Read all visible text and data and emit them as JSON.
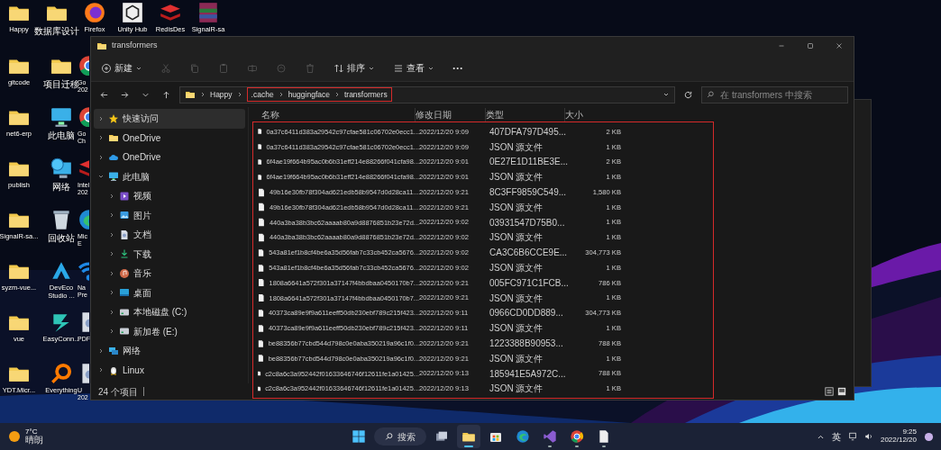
{
  "desktop": {
    "top_row": [
      {
        "label": "Happy",
        "kind": "folder"
      },
      {
        "label": "数据库设计",
        "kind": "folder"
      },
      {
        "label": "Firefox",
        "kind": "browser"
      },
      {
        "label": "Unity Hub",
        "kind": "cube"
      },
      {
        "label": "RedisDes",
        "kind": "stack"
      },
      {
        "label": "SignalR-sa",
        "kind": "archive"
      }
    ],
    "icons": [
      {
        "label": "gitcode",
        "kind": "folder"
      },
      {
        "label": "项目迁移",
        "kind": "folder"
      },
      {
        "label": "Go\n202",
        "kind": "chrome"
      },
      {
        "label": "net6-erp",
        "kind": "folder"
      },
      {
        "label": "此电脑",
        "kind": "monitor"
      },
      {
        "label": "Go\nCh",
        "kind": "chrome"
      },
      {
        "label": "publish",
        "kind": "folder"
      },
      {
        "label": "网络",
        "kind": "globe"
      },
      {
        "label": "Intel\n202",
        "kind": "stack"
      },
      {
        "label": "SignalR-sa...",
        "kind": "folder"
      },
      {
        "label": "回收站",
        "kind": "bin"
      },
      {
        "label": "Mic\nE",
        "kind": "edge"
      },
      {
        "label": "syzm-vue...",
        "kind": "folder"
      },
      {
        "label": "DevEco\nStudio ...",
        "kind": "deveco"
      },
      {
        "label": "Na\nPre",
        "kind": "signal"
      },
      {
        "label": "vue",
        "kind": "folder"
      },
      {
        "label": "EasyConn...",
        "kind": "easy"
      },
      {
        "label": "PDF",
        "kind": "doc"
      },
      {
        "label": "YDT.Micr...",
        "kind": "folder"
      },
      {
        "label": "Everything",
        "kind": "ring"
      },
      {
        "label": "U\n202",
        "kind": "doc"
      }
    ]
  },
  "explorer": {
    "title": "transformers",
    "toolbar": {
      "new": "新建",
      "sort": "排序",
      "view": "查看",
      "more": "···"
    },
    "path": [
      "Happy",
      ".cache",
      "huggingface",
      "transformers"
    ],
    "search_placeholder": "在 transformers 中搜索",
    "sidebar": [
      {
        "label": "快速访问",
        "kind": "star",
        "selected": true,
        "expanded": false
      },
      {
        "label": "OneDrive",
        "kind": "folder",
        "selected": false,
        "expanded": false
      },
      {
        "label": "OneDrive",
        "kind": "cloud",
        "selected": false,
        "expanded": false
      },
      {
        "label": "此电脑",
        "kind": "monitor",
        "selected": false,
        "expanded": true,
        "children": [
          {
            "label": "视频",
            "kind": "video",
            "selected": false,
            "expanded": false
          },
          {
            "label": "图片",
            "kind": "picture",
            "selected": false,
            "expanded": false
          },
          {
            "label": "文档",
            "kind": "doc",
            "selected": false,
            "expanded": false
          },
          {
            "label": "下载",
            "kind": "download",
            "selected": false,
            "expanded": false
          },
          {
            "label": "音乐",
            "kind": "music",
            "selected": false,
            "expanded": false
          },
          {
            "label": "桌面",
            "kind": "desktop",
            "selected": false,
            "expanded": false
          },
          {
            "label": "本地磁盘 (C:)",
            "kind": "drive",
            "selected": false,
            "expanded": false
          },
          {
            "label": "新加卷 (E:)",
            "kind": "drive",
            "selected": false,
            "expanded": false
          }
        ]
      },
      {
        "label": "网络",
        "kind": "network",
        "selected": false,
        "expanded": false
      },
      {
        "label": "Linux",
        "kind": "penguin",
        "selected": false,
        "expanded": false
      }
    ],
    "columns": [
      "名称",
      "修改日期",
      "类型",
      "大小"
    ],
    "files": [
      {
        "name": "0a37c6411d383a29542c97cfae581c06702e0ecc1...",
        "date": "2022/12/20 9:09",
        "type": "407DFA797D495...",
        "size": "2 KB"
      },
      {
        "name": "0a37c6411d383a29542c97cfae581c06702e0ecc1...",
        "date": "2022/12/20 9:09",
        "type": "JSON 源文件",
        "size": "1 KB"
      },
      {
        "name": "6f4ae19f664b95ac0b6b31eff214e88266f041cfa98...",
        "date": "2022/12/20 9:01",
        "type": "0E27E1D11BE3E...",
        "size": "2 KB"
      },
      {
        "name": "6f4ae19f664b95ac0b6b31eff214e88266f041cfa98...",
        "date": "2022/12/20 9:01",
        "type": "JSON 源文件",
        "size": "1 KB"
      },
      {
        "name": "49b16e30fb78f304ad621edb58b9547d0d28ca11...",
        "date": "2022/12/20 9:21",
        "type": "8C3FF9859C549...",
        "size": "1,580 KB"
      },
      {
        "name": "49b16e30fb78f304ad621edb58b9547d0d28ca11...",
        "date": "2022/12/20 9:21",
        "type": "JSON 源文件",
        "size": "1 KB"
      },
      {
        "name": "440a3ba38b3bc62aaaab80a9d8876851b23e72d...",
        "date": "2022/12/20 9:02",
        "type": "03931547D75B0...",
        "size": "1 KB"
      },
      {
        "name": "440a3ba38b3bc62aaaab80a9d8876851b23e72d...",
        "date": "2022/12/20 9:02",
        "type": "JSON 源文件",
        "size": "1 KB"
      },
      {
        "name": "543a81ef1b8cf4be6a35d56fab7c33cb452ca5676...",
        "date": "2022/12/20 9:02",
        "type": "CA3C6B6CCE9E...",
        "size": "304,773 KB"
      },
      {
        "name": "543a81ef1b8cf4be6a35d56fab7c33cb452ca5676...",
        "date": "2022/12/20 9:02",
        "type": "JSON 源文件",
        "size": "1 KB"
      },
      {
        "name": "1808a6641a572f301a37147f4bbdbaa0450170b7...",
        "date": "2022/12/20 9:21",
        "type": "005FC971C1FCB...",
        "size": "786 KB"
      },
      {
        "name": "1808a6641a572f301a37147f4bbdbaa0450170b7...",
        "date": "2022/12/20 9:21",
        "type": "JSON 源文件",
        "size": "1 KB"
      },
      {
        "name": "40373ca89e9f9a611eeff50db230ebf789c215f423...",
        "date": "2022/12/20 9:11",
        "type": "0966CD0DD889...",
        "size": "304,773 KB"
      },
      {
        "name": "40373ca89e9f9a611eeff50db230ebf789c215f423...",
        "date": "2022/12/20 9:11",
        "type": "JSON 源文件",
        "size": "1 KB"
      },
      {
        "name": "be88356b77cbd544d798c0e0aba350219a96c1f0...",
        "date": "2022/12/20 9:21",
        "type": "1223388B90953...",
        "size": "788 KB"
      },
      {
        "name": "be88356b77cbd544d798c0e0aba350219a96c1f0...",
        "date": "2022/12/20 9:21",
        "type": "JSON 源文件",
        "size": "1 KB"
      },
      {
        "name": "c2c8a6c3a952442f01633646746f12611fe1a01425...",
        "date": "2022/12/20 9:13",
        "type": "185941E5A972C...",
        "size": "788 KB"
      },
      {
        "name": "c2c8a6c3a952442f01633646746f12611fe1a01425...",
        "date": "2022/12/20 9:13",
        "type": "JSON 源文件",
        "size": "1 KB"
      }
    ],
    "status": "24 个项目"
  },
  "taskbar": {
    "weather": {
      "temp": "7°C",
      "condition": "晴朗"
    },
    "search": "搜索",
    "apps": [
      {
        "kind": "taskview",
        "running": false,
        "selected": false
      },
      {
        "kind": "explorer",
        "running": true,
        "selected": true
      },
      {
        "kind": "store",
        "running": false,
        "selected": false
      },
      {
        "kind": "edge",
        "running": false,
        "selected": false
      },
      {
        "kind": "vs",
        "running": true,
        "selected": false
      },
      {
        "kind": "chrome",
        "running": true,
        "selected": false
      },
      {
        "kind": "notepad",
        "running": true,
        "selected": false
      }
    ],
    "ime": "英",
    "time": "9:25",
    "date": "2022/12/20"
  }
}
